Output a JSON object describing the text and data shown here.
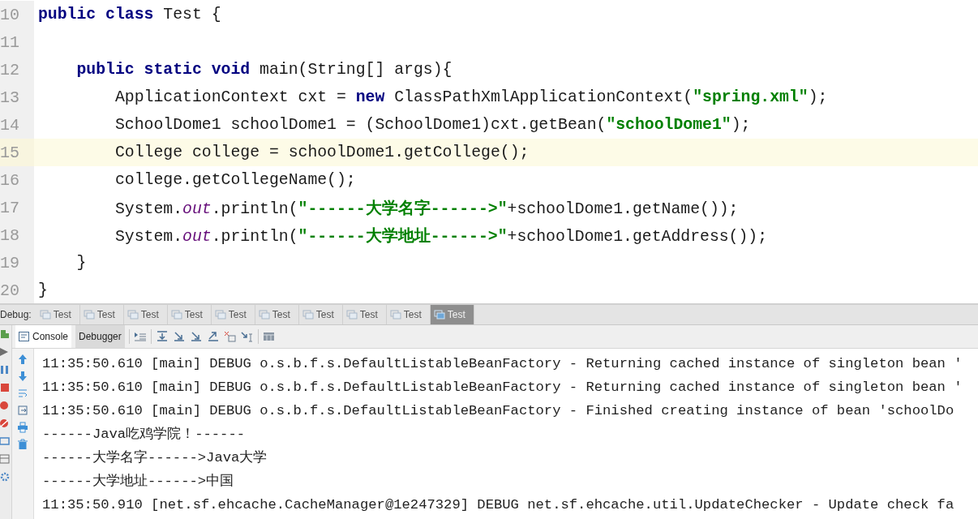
{
  "editor": {
    "lines": [
      {
        "number": "10",
        "current": false,
        "tokens": [
          {
            "kind": "keyword",
            "text": "public class"
          },
          {
            "kind": "plain",
            "text": " Test {"
          }
        ]
      },
      {
        "number": "11",
        "current": false
      },
      {
        "number": "12",
        "current": false,
        "tokens": [
          {
            "kind": "keyword",
            "text": "    public static void"
          },
          {
            "kind": "plain",
            "text": " main(String[] args){"
          }
        ]
      },
      {
        "number": "13",
        "current": false,
        "tokens": [
          {
            "kind": "plain",
            "text": "        ApplicationContext cxt = "
          },
          {
            "kind": "keyword",
            "text": "new"
          },
          {
            "kind": "plain",
            "text": " ClassPathXmlApplicationContext("
          },
          {
            "kind": "string",
            "text": "\"spring.xml\""
          },
          {
            "kind": "plain",
            "text": ");"
          }
        ]
      },
      {
        "number": "14",
        "current": false,
        "tokens": [
          {
            "kind": "plain",
            "text": "        SchoolDome1 schoolDome1 = (SchoolDome1)cxt.getBean("
          },
          {
            "kind": "string",
            "text": "\"schoolDome1\""
          },
          {
            "kind": "plain",
            "text": ");"
          }
        ]
      },
      {
        "number": "15",
        "current": true,
        "tokens": [
          {
            "kind": "plain",
            "text": "        College college = schoolDome1.getCollege();"
          }
        ]
      },
      {
        "number": "16",
        "current": false,
        "tokens": [
          {
            "kind": "plain",
            "text": "        college.getCollegeName();"
          }
        ]
      },
      {
        "number": "17",
        "current": false,
        "tokens": [
          {
            "kind": "plain",
            "text": "        System."
          },
          {
            "kind": "field",
            "text": "out"
          },
          {
            "kind": "plain",
            "text": ".println("
          },
          {
            "kind": "string",
            "text": "\"------大学名字------>\""
          },
          {
            "kind": "plain",
            "text": "+schoolDome1.getName());"
          }
        ]
      },
      {
        "number": "18",
        "current": false,
        "tokens": [
          {
            "kind": "plain",
            "text": "        System."
          },
          {
            "kind": "field",
            "text": "out"
          },
          {
            "kind": "plain",
            "text": ".println("
          },
          {
            "kind": "string",
            "text": "\"------大学地址------>\""
          },
          {
            "kind": "plain",
            "text": "+schoolDome1.getAddress());"
          }
        ]
      },
      {
        "number": "19",
        "current": false,
        "tokens": [
          {
            "kind": "plain",
            "text": "    }"
          }
        ]
      },
      {
        "number": "20",
        "current": false,
        "tokens": [
          {
            "kind": "plain",
            "text": "}"
          }
        ]
      }
    ]
  },
  "debug_bar": {
    "label": "Debug:",
    "tabs": [
      {
        "label": "Test",
        "selected": false
      },
      {
        "label": "Test",
        "selected": false
      },
      {
        "label": "Test",
        "selected": false
      },
      {
        "label": "Test",
        "selected": false
      },
      {
        "label": "Test",
        "selected": false
      },
      {
        "label": "Test",
        "selected": false
      },
      {
        "label": "Test",
        "selected": false
      },
      {
        "label": "Test",
        "selected": false
      },
      {
        "label": "Test",
        "selected": false
      },
      {
        "label": "Test",
        "selected": true
      }
    ]
  },
  "console_tabs": [
    {
      "label": "Console",
      "selected": true
    },
    {
      "label": "Debugger",
      "selected": false
    }
  ],
  "console": {
    "lines": [
      "11:35:50.610 [main] DEBUG o.s.b.f.s.DefaultListableBeanFactory - Returning cached instance of singleton bean '",
      "11:35:50.610 [main] DEBUG o.s.b.f.s.DefaultListableBeanFactory - Returning cached instance of singleton bean '",
      "11:35:50.610 [main] DEBUG o.s.b.f.s.DefaultListableBeanFactory - Finished creating instance of bean 'schoolDo",
      "------Java吃鸡学院！------",
      "------大学名字------>Java大学",
      "------大学地址------>中国",
      "11:35:50.910 [net.sf.ehcache.CacheManager@1e247329] DEBUG net.sf.ehcache.util.UpdateChecker - Update check fa"
    ]
  }
}
